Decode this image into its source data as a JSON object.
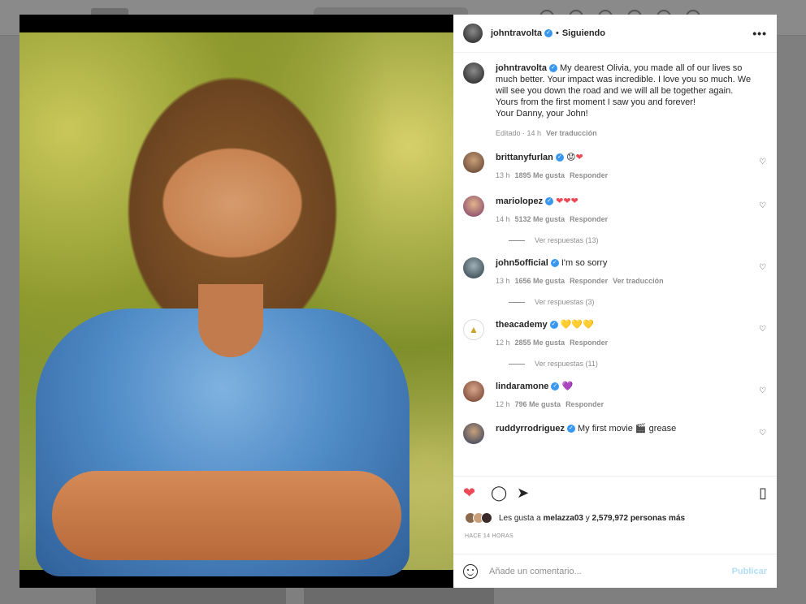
{
  "colors": {
    "accent": "#3897f0",
    "like": "#ed4956",
    "publish_disabled": "#b2dffc"
  },
  "icons": {
    "more": "more-horizontal-icon",
    "like": "heart-filled-icon",
    "comment": "comment-icon",
    "share": "paper-plane-icon",
    "save": "bookmark-icon",
    "emoji": "emoji-icon",
    "comment_like": "heart-outline-icon"
  },
  "post": {
    "author": "johntravolta",
    "follow_status": "Siguiendo",
    "more_label": "•••",
    "caption_lines": [
      "My dearest Olivia, you made all of our lives so",
      "much better. Your impact was incredible. I love you so much. We",
      "will see you down the road and we will all be together again.",
      "Yours from the first moment I saw you and forever!",
      "Your Danny, your John!"
    ],
    "caption_meta": "Editado · 14 h",
    "translate_label": "Ver traducción"
  },
  "comments": [
    {
      "user": "brittanyfurlan",
      "text": "😟",
      "hearts": "❤",
      "time": "13 h",
      "likes": "1895 Me gusta",
      "reply": "Responder",
      "translate": "",
      "replies": ""
    },
    {
      "user": "mariolopez",
      "text": "",
      "hearts": "❤❤❤",
      "time": "14 h",
      "likes": "5132 Me gusta",
      "reply": "Responder",
      "translate": "",
      "replies": "Ver respuestas (13)"
    },
    {
      "user": "john5official",
      "text": "I'm so sorry",
      "hearts": "",
      "time": "13 h",
      "likes": "1656 Me gusta",
      "reply": "Responder",
      "translate": "Ver traducción",
      "replies": "Ver respuestas (3)"
    },
    {
      "user": "theacademy",
      "text": "",
      "hearts": "💛💛💛",
      "time": "12 h",
      "likes": "2855 Me gusta",
      "reply": "Responder",
      "translate": "",
      "replies": "Ver respuestas (11)"
    },
    {
      "user": "lindaramone",
      "text": "",
      "hearts": "💜",
      "time": "12 h",
      "likes": "796 Me gusta",
      "reply": "Responder",
      "translate": "",
      "replies": ""
    },
    {
      "user": "ruddyrrodriguez",
      "text": "My first movie 🎬 grease",
      "hearts": "",
      "time": "",
      "likes": "",
      "reply": "",
      "translate": "",
      "replies": ""
    }
  ],
  "likes_summary": {
    "prefix": "Les gusta a",
    "user": "melazza03",
    "conj": "y",
    "rest": "2,579,972 personas más"
  },
  "time_ago": "HACE 14 HORAS",
  "comment_input": {
    "placeholder": "Añade un comentario...",
    "value": ""
  },
  "publish_label": "Publicar"
}
